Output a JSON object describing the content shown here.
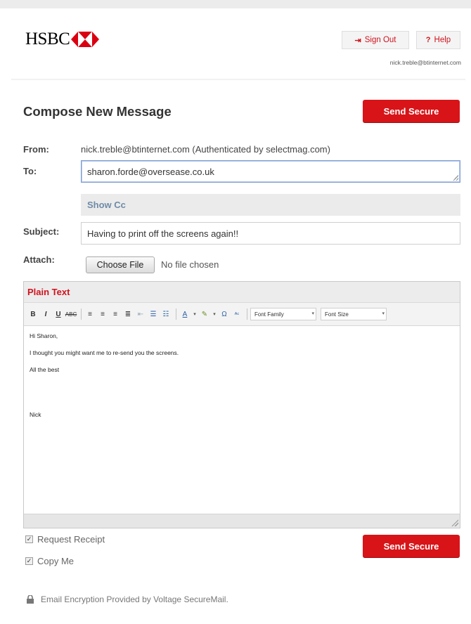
{
  "header": {
    "logo_text": "HSBC",
    "sign_out_label": "Sign Out",
    "help_label": "Help",
    "user_email": "nick.treble@btinternet.com"
  },
  "compose": {
    "title": "Compose New Message",
    "send_label": "Send Secure",
    "from_label": "From:",
    "from_value": "nick.treble@btinternet.com (Authenticated by selectmag.com)",
    "to_label": "To:",
    "to_value": "sharon.forde@oversease.co.uk",
    "show_cc_label": "Show Cc",
    "subject_label": "Subject:",
    "subject_value": "Having to print off the screens again!!",
    "attach_label": "Attach:",
    "choose_file_label": "Choose File",
    "no_file_text": "No file chosen"
  },
  "editor": {
    "mode_label": "Plain Text",
    "font_family_label": "Font Family",
    "font_size_label": "Font Size",
    "body_lines": [
      "Hi Sharon,",
      "I thought you might want me to re-send you the screens.",
      "All the best",
      "Nick"
    ]
  },
  "options": {
    "request_receipt_label": "Request Receipt",
    "request_receipt_checked": true,
    "copy_me_label": "Copy Me",
    "copy_me_checked": true
  },
  "footer": {
    "encryption_text": "Email Encryption Provided by Voltage SecureMail."
  },
  "colors": {
    "brand_red": "#d81418",
    "link_blue": "#6f8ba8"
  }
}
